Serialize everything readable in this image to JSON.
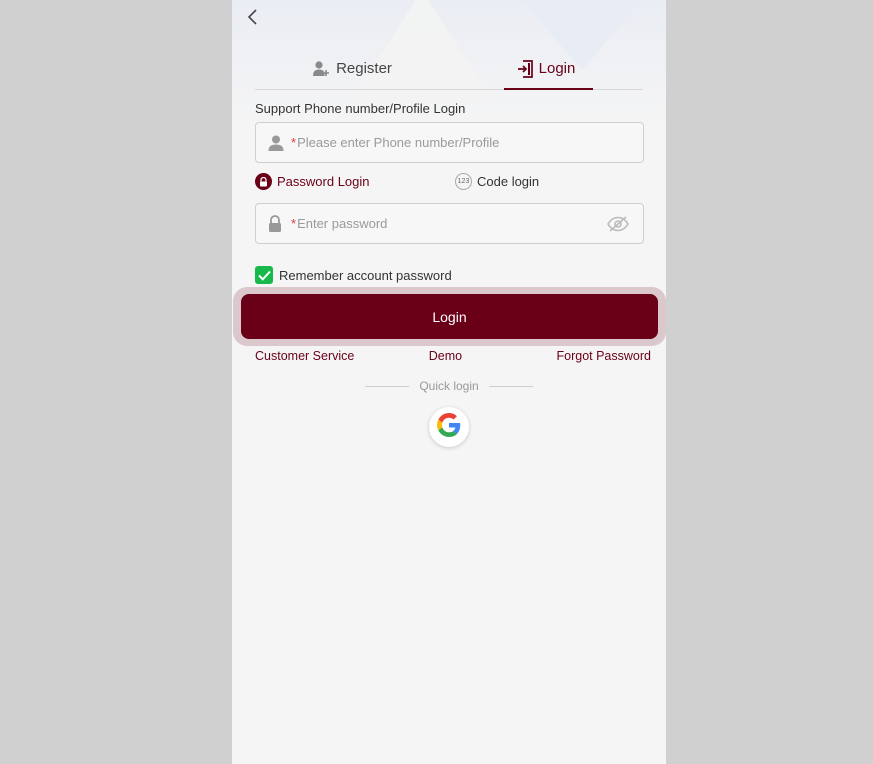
{
  "tabs": [
    {
      "label": "Register",
      "icon": "add-user-icon"
    },
    {
      "label": "Login",
      "icon": "login-door-icon"
    }
  ],
  "form": {
    "support_label": "Support Phone number/Profile Login",
    "account_required_mark": "*",
    "account_placeholder": "Please enter Phone number/Profile",
    "password_required_mark": "*",
    "password_placeholder": "Enter password"
  },
  "modes": {
    "password_login": "Password Login",
    "code_login": "Code login",
    "code_badge": "123"
  },
  "remember_label": "Remember account password",
  "login_button": "Login",
  "links": {
    "customer_service": "Customer Service",
    "demo": "Demo",
    "forgot_password": "Forgot Password"
  },
  "quick_login_label": "Quick login",
  "colors": {
    "brand": "#6a0018",
    "check": "#18b84a",
    "required": "#e0393a"
  }
}
